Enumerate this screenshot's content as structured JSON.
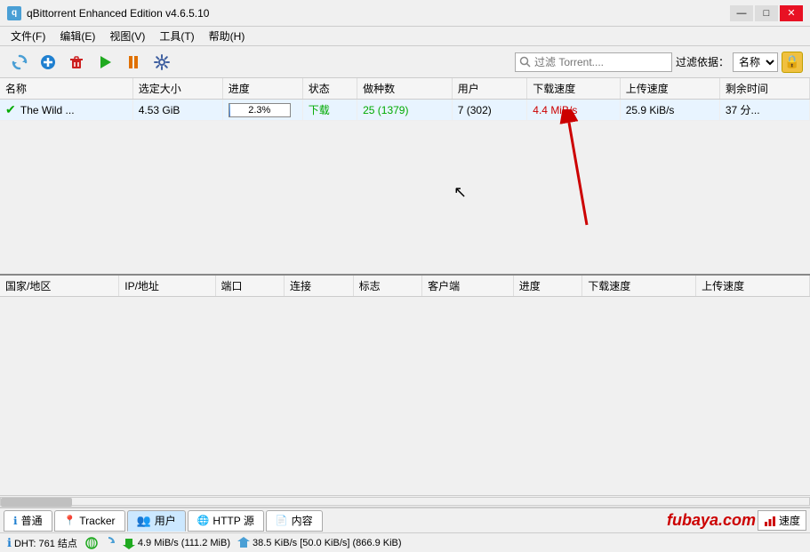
{
  "titlebar": {
    "icon": "q",
    "title": "qBittorrent Enhanced Edition v4.6.5.10",
    "minimize": "—",
    "maximize": "□",
    "close": "✕"
  },
  "menu": {
    "items": [
      "文件(F)",
      "编辑(E)",
      "视图(V)",
      "工具(T)",
      "帮助(H)"
    ]
  },
  "toolbar": {
    "buttons": [
      "refresh",
      "add",
      "delete",
      "play",
      "pause",
      "settings"
    ],
    "search_placeholder": "过滤 Torrent....",
    "filter_label": "过滤依据：",
    "filter_value": "名称"
  },
  "torrent_table": {
    "columns": [
      "名称",
      "选定大小",
      "进度",
      "状态",
      "做种数",
      "用户",
      "下载速度",
      "上传速度",
      "剩余时间"
    ],
    "rows": [
      {
        "name": "The Wild ...",
        "size": "4.53 GiB",
        "progress": "2.3%",
        "status": "下载",
        "seeds": "25 (1379)",
        "users": "7 (302)",
        "dl_speed": "4.4 MiB/s",
        "ul_speed": "25.9 KiB/s",
        "remaining": "37 分..."
      }
    ]
  },
  "lower_table": {
    "columns": [
      "国家/地区",
      "IP/地址",
      "端口",
      "连接",
      "标志",
      "客户端",
      "进度",
      "下载速度",
      "上传速"
    ]
  },
  "tabs": [
    {
      "id": "normal",
      "label": "普通",
      "icon": "ℹ",
      "active": false
    },
    {
      "id": "tracker",
      "label": "Tracker",
      "icon": "📍",
      "active": false
    },
    {
      "id": "users",
      "label": "用户",
      "icon": "👥",
      "active": true
    },
    {
      "id": "http",
      "label": "HTTP 源",
      "icon": "🌐",
      "active": false
    },
    {
      "id": "content",
      "label": "内容",
      "icon": "📄",
      "active": false
    }
  ],
  "watermark": "fubaya.com",
  "speed_btn": "速度",
  "statusbar": {
    "dht": "DHT: 761 结点",
    "dl_rate": "4.9 MiB/s (111.2 MiB)",
    "ul_rate": "38.5 KiB/s [50.0 KiB/s] (866.9 KiB)"
  }
}
